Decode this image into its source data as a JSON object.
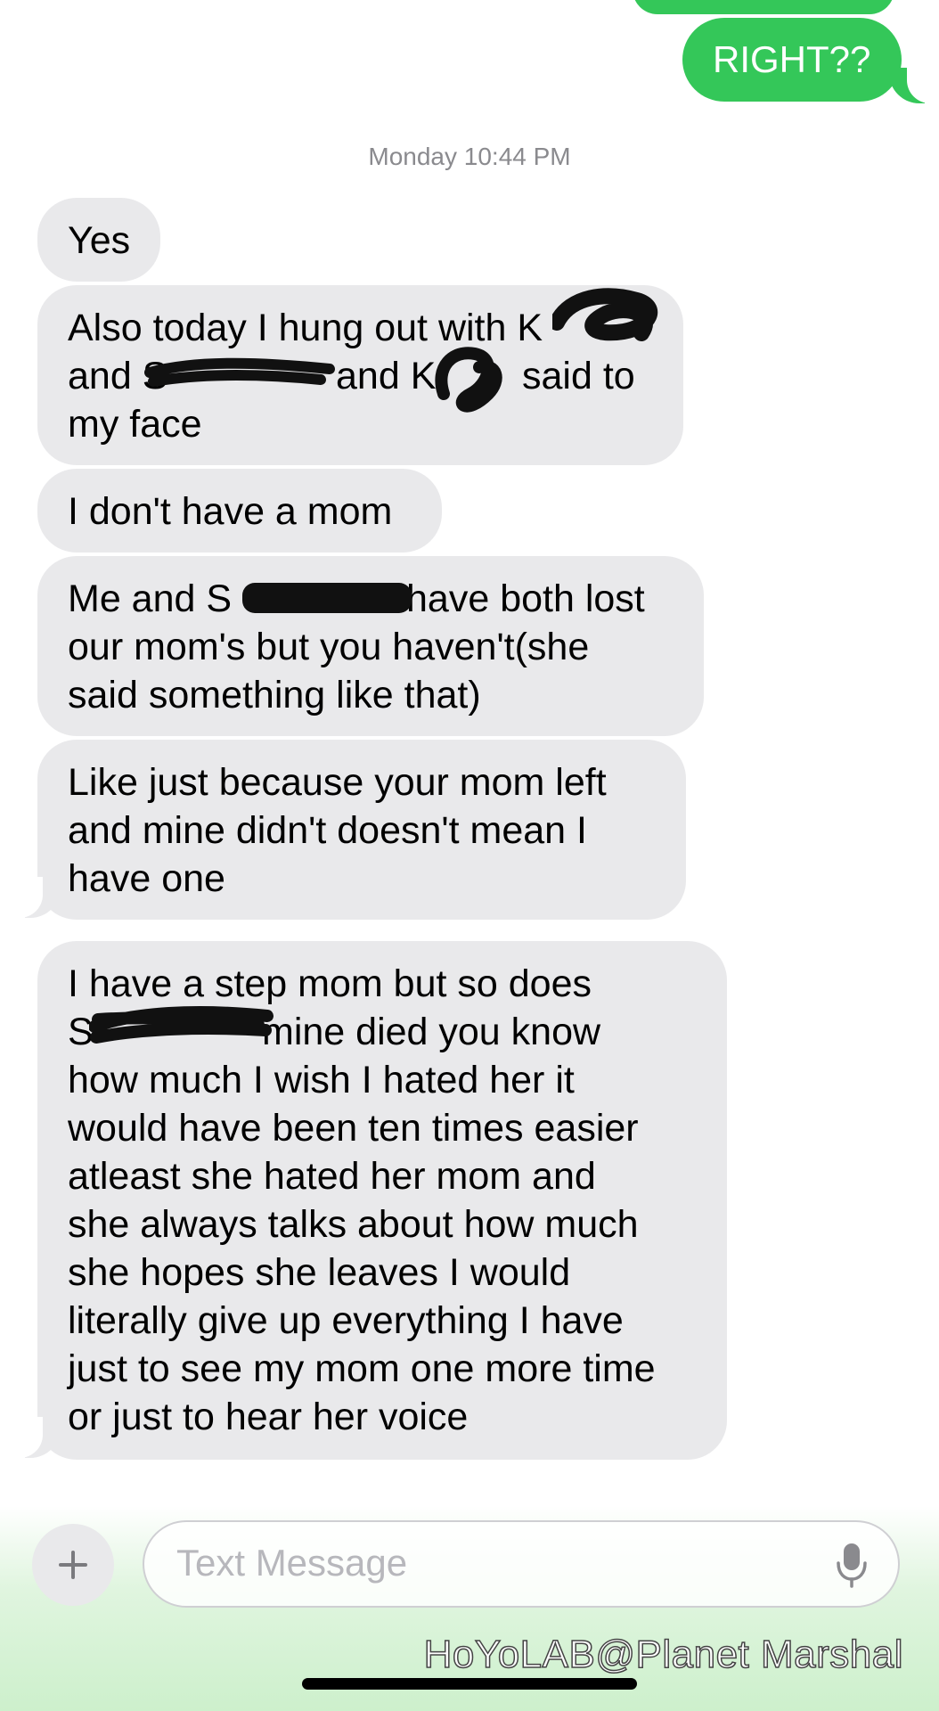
{
  "conversation": {
    "sent_top": "RIGHT??",
    "timestamp": "Monday 10:44 PM",
    "messages": [
      {
        "lines": [
          "Yes"
        ]
      },
      {
        "lines": [
          "Also today I hung out with K",
          "and S",
          "and K",
          "said to",
          "my face"
        ]
      },
      {
        "lines": [
          "I don't have a mom"
        ]
      },
      {
        "lines": [
          "Me and S",
          "have both lost",
          "our mom's but you haven't(she",
          "said something like that)"
        ]
      },
      {
        "lines": [
          "Like just because your mom left",
          "and mine didn't doesn't mean I",
          "have one"
        ]
      },
      {
        "lines": [
          "I have a step mom but so does",
          "S",
          "mine died you know",
          "how much I wish I hated her it",
          "would have been ten times easier",
          "atleast she hated her mom and",
          "she always talks about how much",
          "she hopes she leaves I would",
          "literally give up everything I have",
          "just to see my mom one more time",
          "or just to hear her voice"
        ]
      }
    ]
  },
  "input_bar": {
    "placeholder": "Text Message",
    "plus_icon": "plus-icon",
    "mic_icon": "microphone-icon"
  },
  "watermark": "HoYoLAB@Planet Marshal",
  "colors": {
    "sent_bubble": "#34c759",
    "received_bubble": "#e9e9eb",
    "timestamp": "#8a8a8e"
  }
}
